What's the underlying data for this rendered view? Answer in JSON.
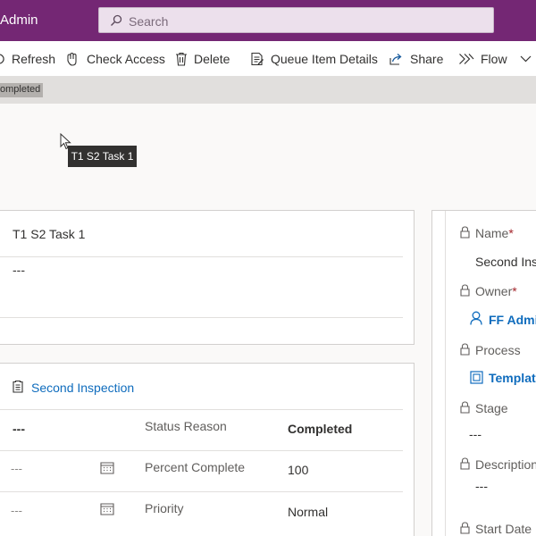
{
  "header": {
    "app_title": "Admin",
    "search_placeholder": "Search"
  },
  "commands": {
    "refresh": "Refresh",
    "check_access": "Check Access",
    "delete": "Delete",
    "queue_item_details": "Queue Item Details",
    "share": "Share",
    "flow": "Flow"
  },
  "status": {
    "label": "ompleted"
  },
  "tooltip": {
    "text": "T1 S2 Task 1"
  },
  "task_card": {
    "title": "T1 S2 Task 1",
    "description": "---"
  },
  "details_card": {
    "regarding": "Second Inspection",
    "left_value": "---",
    "row1_label": "Status Reason",
    "row1_value": "Completed",
    "row2_date": "---",
    "row2_label": "Percent Complete",
    "row2_value": "100",
    "row3_date": "---",
    "row3_label": "Priority",
    "row3_value": "Normal"
  },
  "side_panel": {
    "name_label": "Name",
    "name_value": "Second Insp",
    "owner_label": "Owner",
    "owner_value": "FF Admin",
    "process_label": "Process",
    "process_value": "Template",
    "stage_label": "Stage",
    "stage_value": "---",
    "description_label": "Description",
    "description_value": "---",
    "start_date_label": "Start Date",
    "required_marker": "*"
  },
  "colors": {
    "topbar": "#742774",
    "link": "#0f6cbd",
    "required": "#a4262c"
  }
}
